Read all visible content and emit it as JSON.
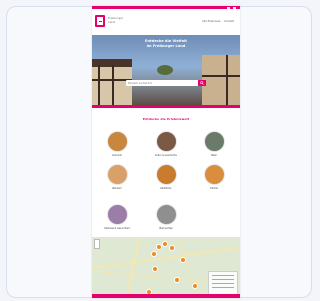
{
  "brand": {
    "name": "Freiburger Land",
    "accent": "#e6006e"
  },
  "nav": {
    "items": [
      "Alle Erlebnisse",
      "Kontakt"
    ]
  },
  "hero": {
    "title_line1": "Entdecke die Vielfalt",
    "title_line2": "im Freiburger Land",
    "search_placeholder": "Wonach suchst du?"
  },
  "categories": {
    "title": "Entdecke die Erlebniswelt",
    "items": [
      {
        "label": "Kulinarik",
        "color": "#c9863f"
      },
      {
        "label": "Kultur & Geschichte",
        "color": "#7b5a45"
      },
      {
        "label": "Natur",
        "color": "#6b7b6a"
      },
      {
        "label": "Wandern",
        "color": "#d9a06a"
      },
      {
        "label": "Radfahren",
        "color": "#c97b2e"
      },
      {
        "label": "Familie",
        "color": "#d98e3e"
      },
      {
        "label": "Wellness & Gesundheit",
        "color": "#9a7ea8"
      },
      {
        "label": "Übernachten",
        "color": "#8f8f8f"
      }
    ]
  },
  "map": {
    "legend_label": "Karte"
  }
}
